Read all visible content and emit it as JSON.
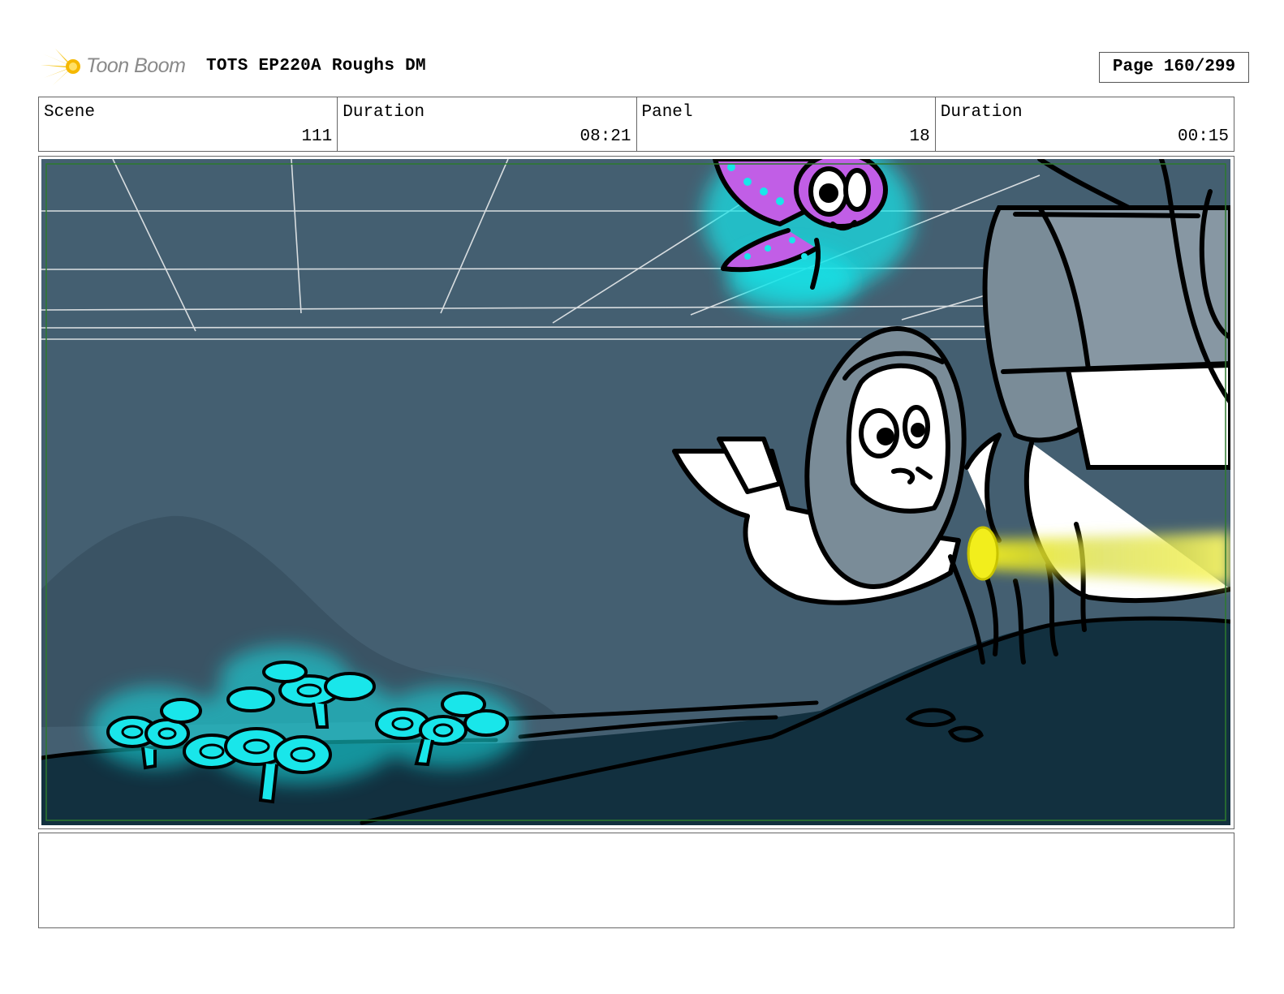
{
  "header": {
    "logo_text": "Toon Boom",
    "doc_title": "TOTS EP220A Roughs DM",
    "page": "Page 160/299"
  },
  "info": {
    "scene_label": "Scene",
    "scene_value": "111",
    "scene_duration_label": "Duration",
    "scene_duration_value": "08:21",
    "panel_label": "Panel",
    "panel_value": "18",
    "panel_duration_label": "Duration",
    "panel_duration_value": "00:15"
  },
  "notes": {
    "text": ""
  },
  "colors": {
    "sky": "#445f71",
    "hill": "#3a5364",
    "ground": "#12303f",
    "glow_cyan": "#19e6ea",
    "creature_purple": "#c15ee6",
    "flashlight_yellow": "#f2ee1c",
    "safe_frame": "#2d7a2d"
  }
}
